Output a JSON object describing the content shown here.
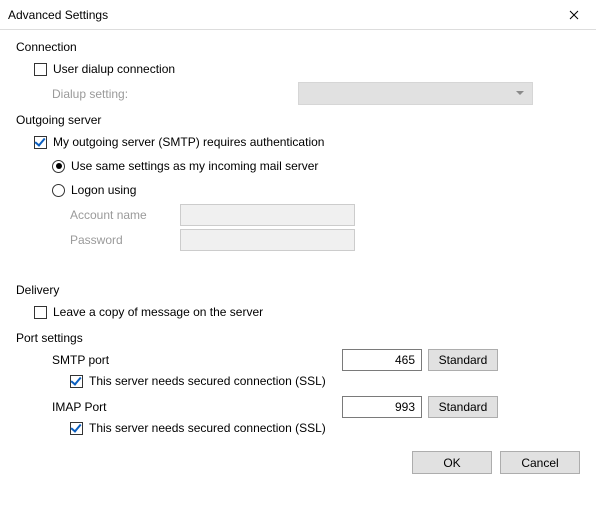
{
  "title": "Advanced Settings",
  "connection": {
    "title": "Connection",
    "dialup_checkbox": "User dialup connection",
    "dialup_checked": false,
    "dialup_setting_label": "Dialup setting:"
  },
  "outgoing": {
    "title": "Outgoing server",
    "smtp_auth_label": "My outgoing server (SMTP) requires authentication",
    "smtp_auth_checked": true,
    "radio_same_label": "Use same settings as my incoming mail server",
    "radio_logon_label": "Logon using",
    "radio_selected": "same",
    "account_name_label": "Account name",
    "account_name_value": "",
    "password_label": "Password",
    "password_value": ""
  },
  "delivery": {
    "title": "Delivery",
    "leave_copy_label": "Leave a copy of message on the server",
    "leave_copy_checked": false
  },
  "ports": {
    "title": "Port settings",
    "smtp_label": "SMTP port",
    "smtp_value": "465",
    "smtp_standard": "Standard",
    "smtp_ssl_label": "This server needs secured connection (SSL)",
    "smtp_ssl_checked": true,
    "imap_label": "IMAP Port",
    "imap_value": "993",
    "imap_standard": "Standard",
    "imap_ssl_label": "This server needs secured connection (SSL)",
    "imap_ssl_checked": true
  },
  "buttons": {
    "ok": "OK",
    "cancel": "Cancel"
  }
}
